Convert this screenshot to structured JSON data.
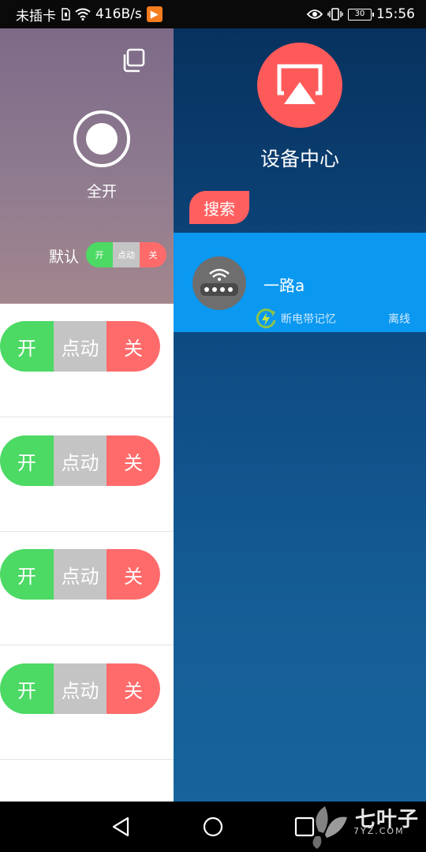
{
  "status_bar": {
    "carrier": "未插卡",
    "net_speed": "416B/s",
    "battery": "30",
    "time": "15:56"
  },
  "left_panel": {
    "all_on_label": "全开",
    "default_label": "默认",
    "mini_switch": {
      "on": "开",
      "pulse": "点动",
      "off": "关"
    },
    "channels": [
      {
        "on": "开",
        "pulse": "点动",
        "off": "关"
      },
      {
        "on": "开",
        "pulse": "点动",
        "off": "关"
      },
      {
        "on": "开",
        "pulse": "点动",
        "off": "关"
      },
      {
        "on": "开",
        "pulse": "点动",
        "off": "关"
      }
    ]
  },
  "right_panel": {
    "title": "设备中心",
    "search_label": "搜索",
    "devices": [
      {
        "name": "一路a",
        "memory_label": "断电带记忆",
        "status": "离线"
      }
    ]
  },
  "watermark": {
    "text": "七叶子",
    "sub": "7YZ.COM"
  },
  "colors": {
    "on": "#4cd964",
    "pulse": "#c4c4c4",
    "off": "#ff6b6b",
    "accent_red": "#ff5a5a",
    "card_blue": "#0a98f0"
  }
}
